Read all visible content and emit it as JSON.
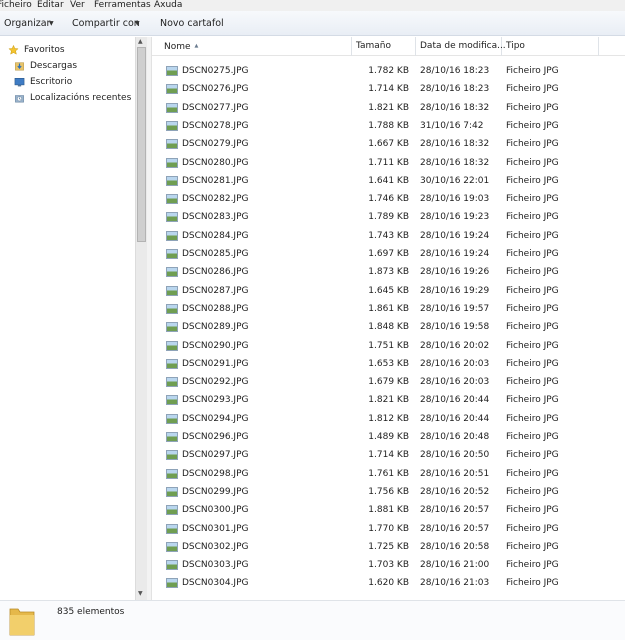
{
  "menu": [
    "Ficheiro",
    "Editar",
    "Ver",
    "Ferramentas",
    "Axuda"
  ],
  "commands": [
    {
      "label": "Organizar",
      "has_dropdown": true
    },
    {
      "label": "Compartir con",
      "has_dropdown": true
    },
    {
      "label": "Novo cartafol",
      "has_dropdown": false
    }
  ],
  "nav": {
    "favorites_label": "Favoritos",
    "items": [
      {
        "label": "Descargas",
        "icon": "downloads-folder-icon"
      },
      {
        "label": "Escritorio",
        "icon": "desktop-icon"
      },
      {
        "label": "Localizacións recentes",
        "icon": "recent-places-icon"
      }
    ]
  },
  "columns": {
    "name": "Nome",
    "size": "Tamaño",
    "date": "Data de modifica...",
    "type": "Tipo"
  },
  "files": [
    {
      "name": "DSCN0275.JPG",
      "size": "1.782 KB",
      "date": "28/10/16 18:23",
      "type": "Ficheiro JPG"
    },
    {
      "name": "DSCN0276.JPG",
      "size": "1.714 KB",
      "date": "28/10/16 18:23",
      "type": "Ficheiro JPG"
    },
    {
      "name": "DSCN0277.JPG",
      "size": "1.821 KB",
      "date": "28/10/16 18:32",
      "type": "Ficheiro JPG"
    },
    {
      "name": "DSCN0278.JPG",
      "size": "1.788 KB",
      "date": "31/10/16 7:42",
      "type": "Ficheiro JPG"
    },
    {
      "name": "DSCN0279.JPG",
      "size": "1.667 KB",
      "date": "28/10/16 18:32",
      "type": "Ficheiro JPG"
    },
    {
      "name": "DSCN0280.JPG",
      "size": "1.711 KB",
      "date": "28/10/16 18:32",
      "type": "Ficheiro JPG"
    },
    {
      "name": "DSCN0281.JPG",
      "size": "1.641 KB",
      "date": "30/10/16 22:01",
      "type": "Ficheiro JPG"
    },
    {
      "name": "DSCN0282.JPG",
      "size": "1.746 KB",
      "date": "28/10/16 19:03",
      "type": "Ficheiro JPG"
    },
    {
      "name": "DSCN0283.JPG",
      "size": "1.789 KB",
      "date": "28/10/16 19:23",
      "type": "Ficheiro JPG"
    },
    {
      "name": "DSCN0284.JPG",
      "size": "1.743 KB",
      "date": "28/10/16 19:24",
      "type": "Ficheiro JPG"
    },
    {
      "name": "DSCN0285.JPG",
      "size": "1.697 KB",
      "date": "28/10/16 19:24",
      "type": "Ficheiro JPG"
    },
    {
      "name": "DSCN0286.JPG",
      "size": "1.873 KB",
      "date": "28/10/16 19:26",
      "type": "Ficheiro JPG"
    },
    {
      "name": "DSCN0287.JPG",
      "size": "1.645 KB",
      "date": "28/10/16 19:29",
      "type": "Ficheiro JPG"
    },
    {
      "name": "DSCN0288.JPG",
      "size": "1.861 KB",
      "date": "28/10/16 19:57",
      "type": "Ficheiro JPG"
    },
    {
      "name": "DSCN0289.JPG",
      "size": "1.848 KB",
      "date": "28/10/16 19:58",
      "type": "Ficheiro JPG"
    },
    {
      "name": "DSCN0290.JPG",
      "size": "1.751 KB",
      "date": "28/10/16 20:02",
      "type": "Ficheiro JPG"
    },
    {
      "name": "DSCN0291.JPG",
      "size": "1.653 KB",
      "date": "28/10/16 20:03",
      "type": "Ficheiro JPG"
    },
    {
      "name": "DSCN0292.JPG",
      "size": "1.679 KB",
      "date": "28/10/16 20:03",
      "type": "Ficheiro JPG"
    },
    {
      "name": "DSCN0293.JPG",
      "size": "1.821 KB",
      "date": "28/10/16 20:44",
      "type": "Ficheiro JPG"
    },
    {
      "name": "DSCN0294.JPG",
      "size": "1.812 KB",
      "date": "28/10/16 20:44",
      "type": "Ficheiro JPG"
    },
    {
      "name": "DSCN0296.JPG",
      "size": "1.489 KB",
      "date": "28/10/16 20:48",
      "type": "Ficheiro JPG"
    },
    {
      "name": "DSCN0297.JPG",
      "size": "1.714 KB",
      "date": "28/10/16 20:50",
      "type": "Ficheiro JPG"
    },
    {
      "name": "DSCN0298.JPG",
      "size": "1.761 KB",
      "date": "28/10/16 20:51",
      "type": "Ficheiro JPG"
    },
    {
      "name": "DSCN0299.JPG",
      "size": "1.756 KB",
      "date": "28/10/16 20:52",
      "type": "Ficheiro JPG"
    },
    {
      "name": "DSCN0300.JPG",
      "size": "1.881 KB",
      "date": "28/10/16 20:57",
      "type": "Ficheiro JPG"
    },
    {
      "name": "DSCN0301.JPG",
      "size": "1.770 KB",
      "date": "28/10/16 20:57",
      "type": "Ficheiro JPG"
    },
    {
      "name": "DSCN0302.JPG",
      "size": "1.725 KB",
      "date": "28/10/16 20:58",
      "type": "Ficheiro JPG"
    },
    {
      "name": "DSCN0303.JPG",
      "size": "1.703 KB",
      "date": "28/10/16 21:00",
      "type": "Ficheiro JPG"
    },
    {
      "name": "DSCN0304.JPG",
      "size": "1.620 KB",
      "date": "28/10/16 21:03",
      "type": "Ficheiro JPG"
    }
  ],
  "status": {
    "count": "835 elementos"
  },
  "colors": {
    "accent": "#3c7fb1",
    "toolbar": "#e9eef5"
  }
}
